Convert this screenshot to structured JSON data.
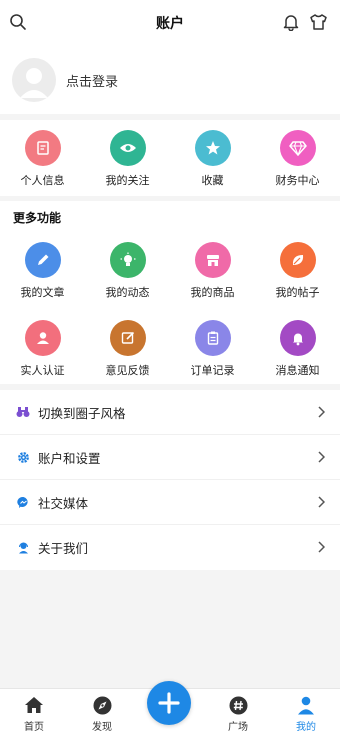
{
  "header": {
    "title": "账户"
  },
  "profile": {
    "login_label": "点击登录"
  },
  "quick": [
    {
      "label": "个人信息",
      "color": "#f27a82",
      "icon": "edit-note-icon"
    },
    {
      "label": "我的关注",
      "color": "#2fb593",
      "icon": "eye-icon"
    },
    {
      "label": "收藏",
      "color": "#4bbcd1",
      "icon": "star-icon"
    },
    {
      "label": "财务中心",
      "color": "#f05fc1",
      "icon": "diamond-icon"
    }
  ],
  "more": {
    "title": "更多功能",
    "row1": [
      {
        "label": "我的文章",
        "color": "#4c8ee8",
        "icon": "pencil-icon"
      },
      {
        "label": "我的动态",
        "color": "#3cb56a",
        "icon": "bulb-icon"
      },
      {
        "label": "我的商品",
        "color": "#f06aa8",
        "icon": "shop-icon"
      },
      {
        "label": "我的帖子",
        "color": "#f56f3b",
        "icon": "leaf-icon"
      }
    ],
    "row2": [
      {
        "label": "实人认证",
        "color": "#f26f7d",
        "icon": "person-icon"
      },
      {
        "label": "意见反馈",
        "color": "#c8752f",
        "icon": "feedback-icon"
      },
      {
        "label": "订单记录",
        "color": "#8a86e8",
        "icon": "clipboard-icon"
      },
      {
        "label": "消息通知",
        "color": "#a34ac4",
        "icon": "bell-icon"
      }
    ]
  },
  "list": [
    {
      "label": "切换到圈子风格",
      "icon": "binoculars-icon"
    },
    {
      "label": "账户和设置",
      "icon": "settings-icon"
    },
    {
      "label": "社交媒体",
      "icon": "messenger-icon"
    },
    {
      "label": "关于我们",
      "icon": "support-agent-icon"
    }
  ],
  "tabs": [
    {
      "label": "首页",
      "icon": "home-icon"
    },
    {
      "label": "发现",
      "icon": "compass-icon"
    },
    {
      "label": "",
      "icon": "plus-icon"
    },
    {
      "label": "广场",
      "icon": "hashtag-icon"
    },
    {
      "label": "我的",
      "icon": "user-icon"
    }
  ],
  "colors": {
    "accent": "#1e88e5"
  }
}
